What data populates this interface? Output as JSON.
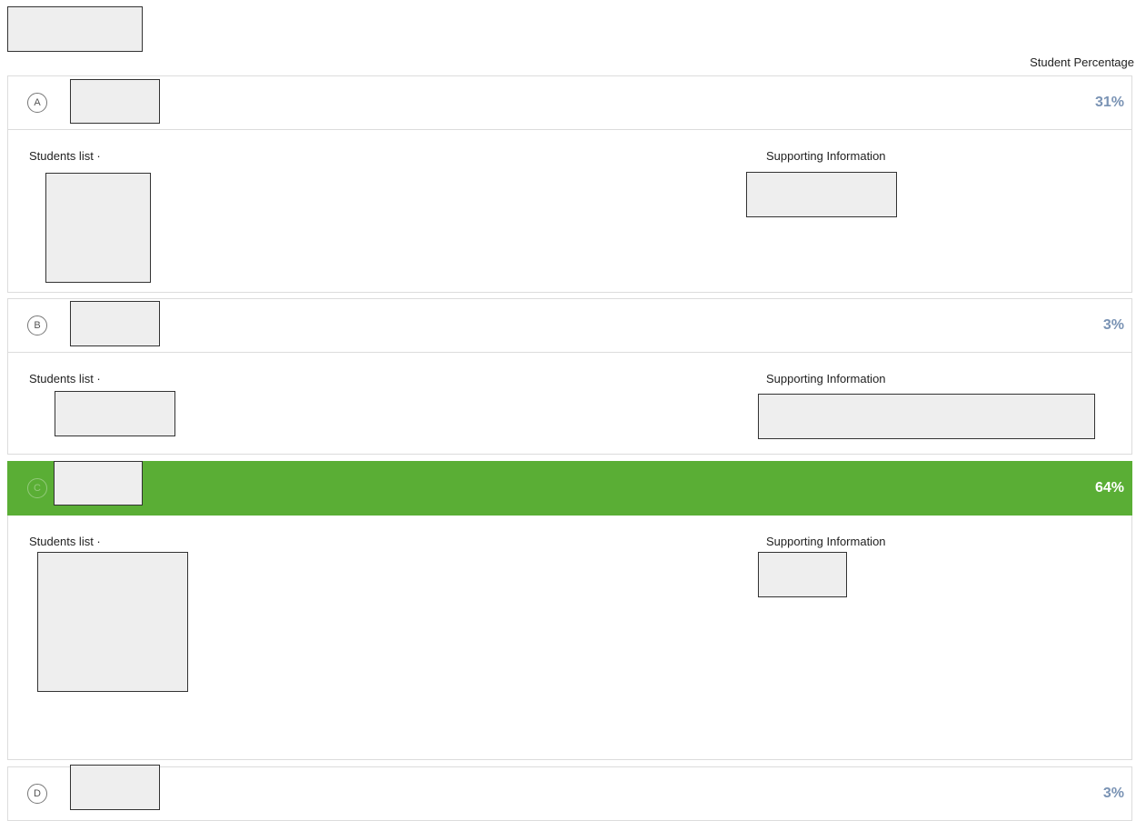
{
  "header": {
    "percentage_label": "Student Percentage"
  },
  "options": [
    {
      "letter": "A",
      "percentage": "31%",
      "students_label": "Students list ·",
      "support_label": "Supporting Information"
    },
    {
      "letter": "B",
      "percentage": "3%",
      "students_label": "Students list ·",
      "support_label": "Supporting Information"
    },
    {
      "letter": "C",
      "percentage": "64%",
      "students_label": "Students list ·",
      "support_label": "Supporting Information",
      "correct": true
    },
    {
      "letter": "D",
      "percentage": "3%"
    }
  ],
  "colors": {
    "correct_bg": "#5aae35",
    "percentage_text": "#7a93b4"
  }
}
